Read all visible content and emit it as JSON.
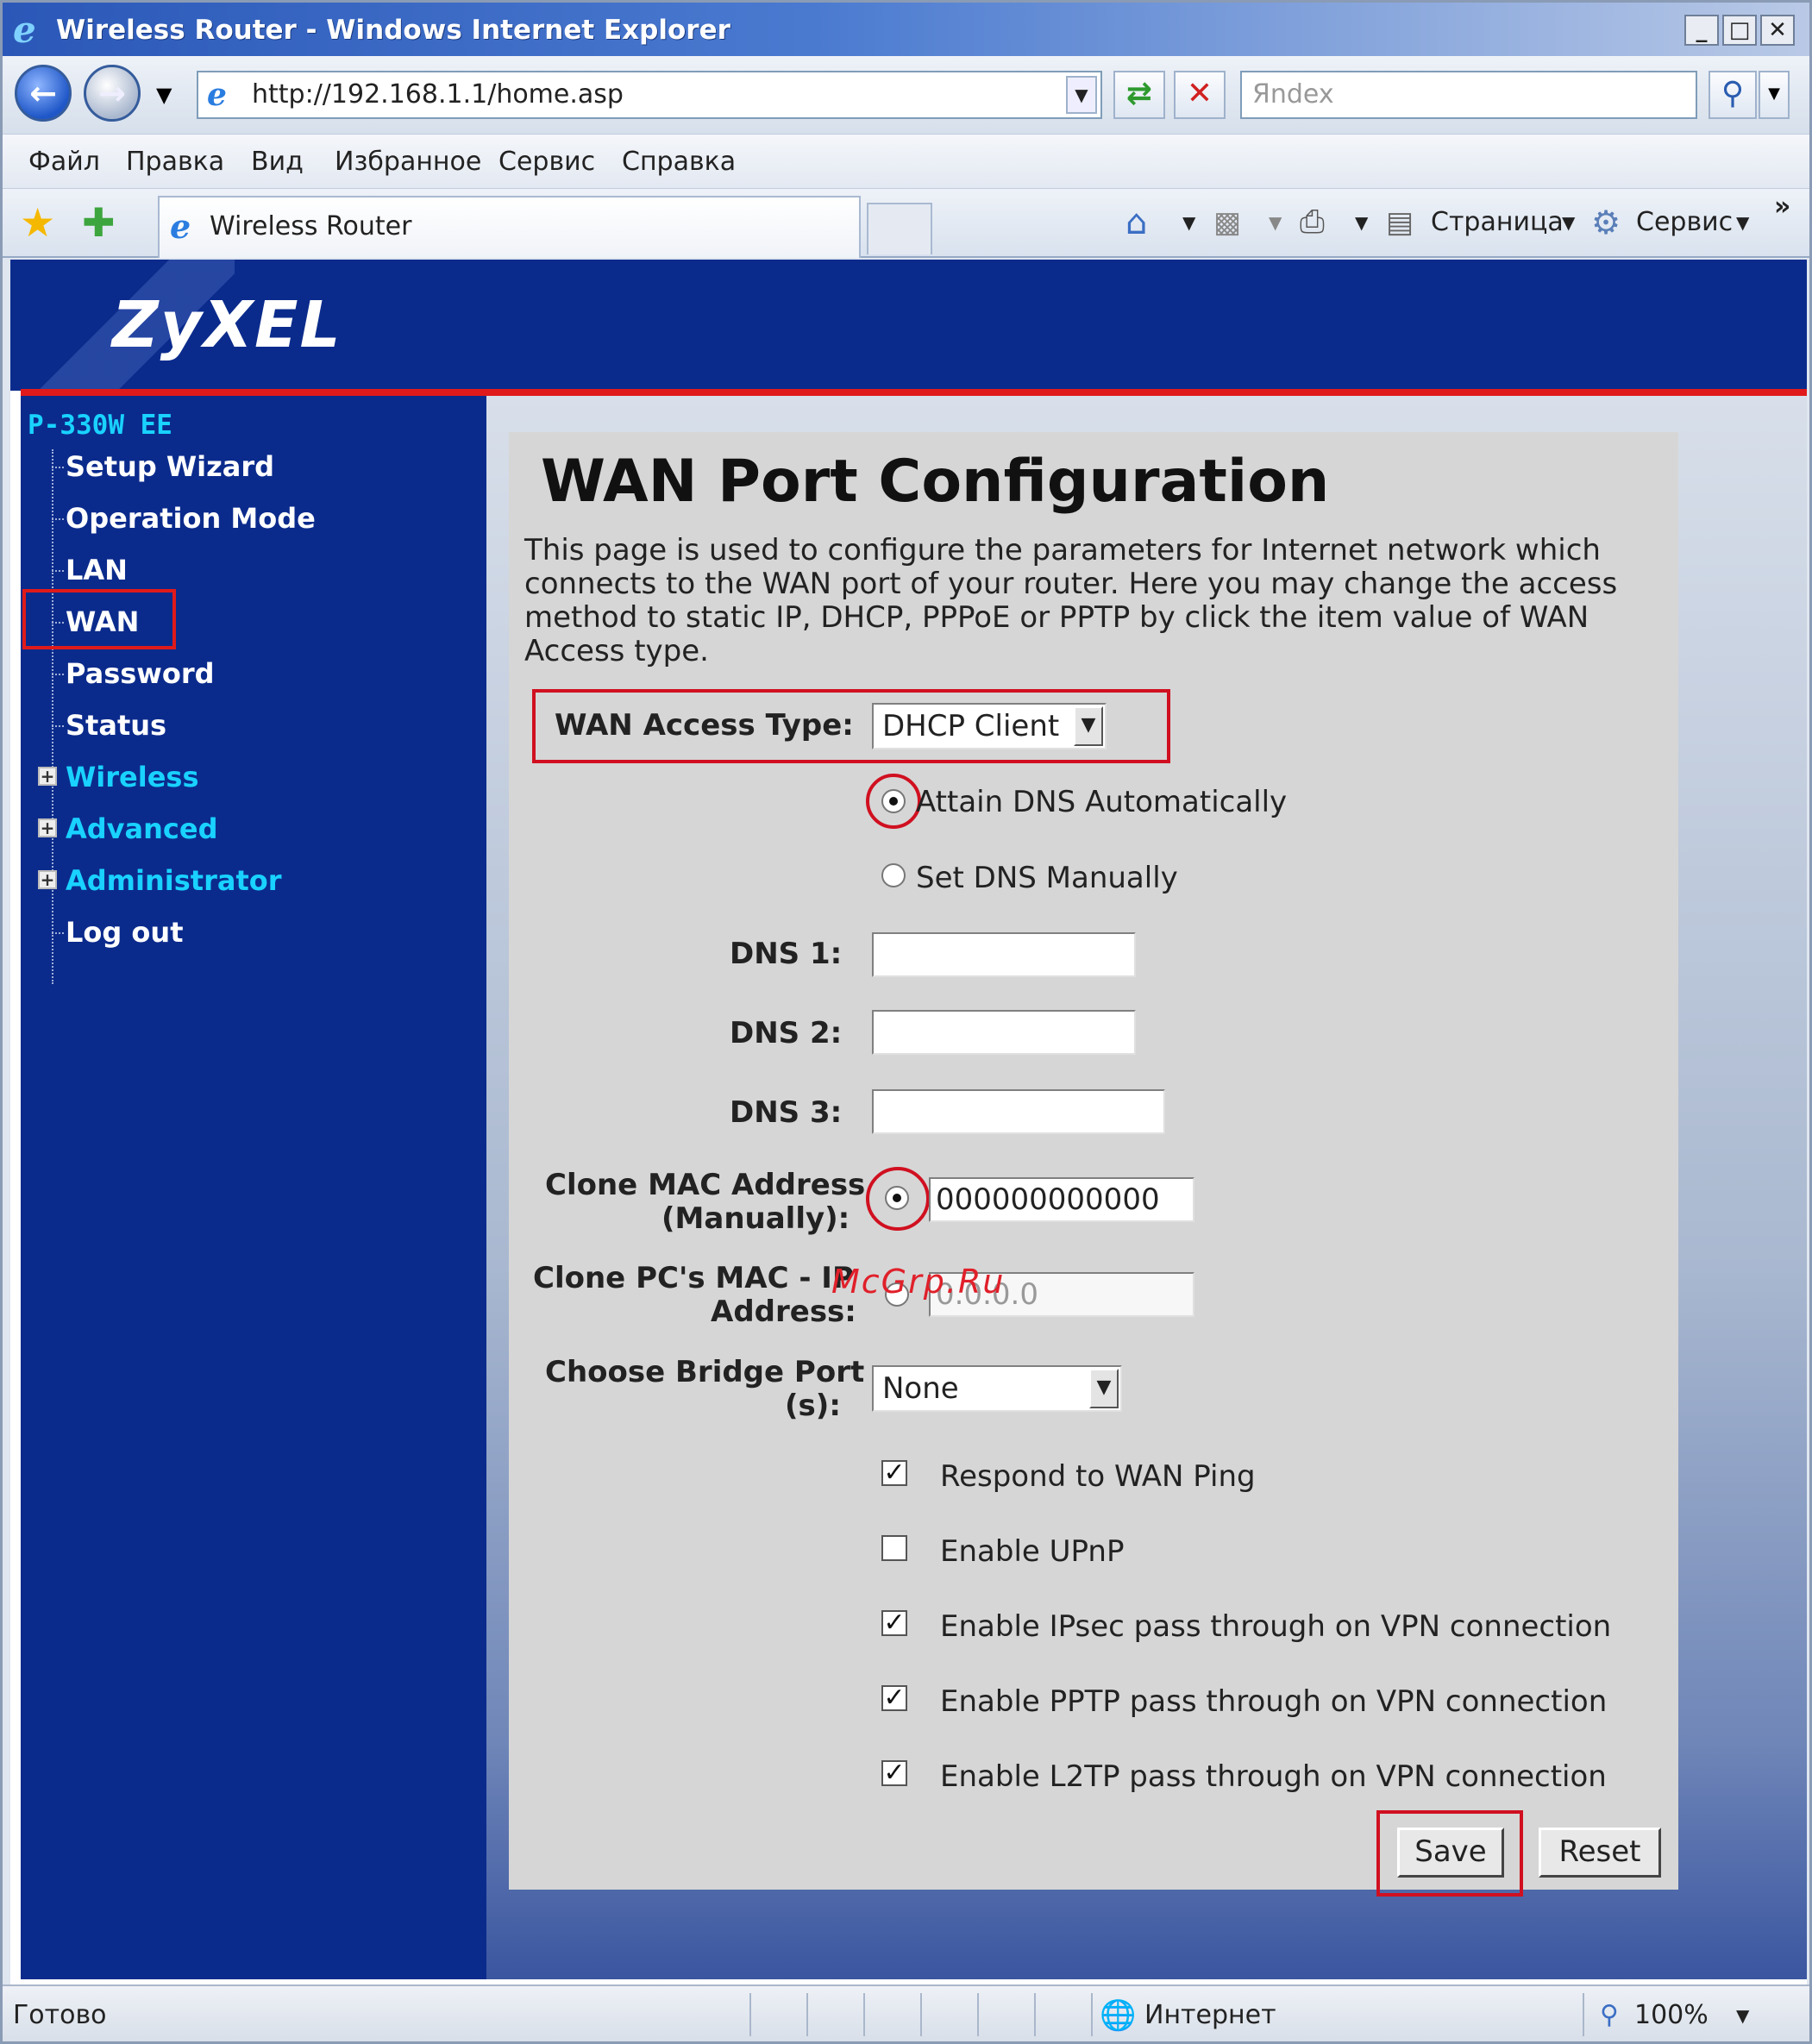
{
  "window": {
    "title": "Wireless Router - Windows Internet Explorer",
    "minimize_glyph": "_",
    "maximize_glyph": "□",
    "close_glyph": "✕"
  },
  "address_bar": {
    "url": "http://192.168.1.1/home.asp",
    "search_placeholder": "Яndex"
  },
  "menu": [
    "Файл",
    "Правка",
    "Вид",
    "Избранное",
    "Сервис",
    "Справка"
  ],
  "tab": {
    "title": "Wireless Router"
  },
  "command_bar": {
    "page_label": "Страница",
    "tools_label": "Сервис"
  },
  "router": {
    "brand": "ZyXEL",
    "model": "P-330W EE",
    "nav": [
      {
        "label": "Setup Wizard"
      },
      {
        "label": "Operation Mode"
      },
      {
        "label": "LAN"
      },
      {
        "label": "WAN"
      },
      {
        "label": "Password"
      },
      {
        "label": "Status"
      },
      {
        "label": "Wireless"
      },
      {
        "label": "Advanced"
      },
      {
        "label": "Administrator"
      },
      {
        "label": "Log out"
      }
    ]
  },
  "form": {
    "title": "WAN Port Configuration",
    "description": "This page is used to configure the parameters for Internet network which connects to the WAN port of your router. Here you may change the access method to static IP, DHCP, PPPoE or PPTP by click the item value of WAN Access type.",
    "wan_access_type_label": "WAN Access Type:",
    "wan_access_type_value": "DHCP Client",
    "dns_auto_label": "Attain DNS Automatically",
    "dns_manual_label": "Set DNS Manually",
    "dns1_label": "DNS 1:",
    "dns1_value": "",
    "dns2_label": "DNS 2:",
    "dns2_value": "",
    "dns3_label": "DNS 3:",
    "dns3_value": "",
    "clone_mac_label_1": "Clone MAC Address",
    "clone_mac_label_2": "(Manually):",
    "clone_mac_value": "000000000000",
    "clone_pc_label_1": "Clone PC's MAC - IP",
    "clone_pc_label_2": "Address:",
    "clone_pc_value": "0.0.0.0",
    "bridge_label_1": "Choose Bridge Port",
    "bridge_label_2": "(s):",
    "bridge_value": "None",
    "options": [
      {
        "label": "Respond to WAN Ping",
        "checked": true
      },
      {
        "label": "Enable UPnP",
        "checked": false
      },
      {
        "label": "Enable IPsec pass through on VPN connection",
        "checked": true
      },
      {
        "label": "Enable PPTP pass through on VPN connection",
        "checked": true
      },
      {
        "label": "Enable L2TP pass through on VPN connection",
        "checked": true
      }
    ],
    "save_label": "Save",
    "reset_label": "Reset"
  },
  "watermark": "McGrp.Ru",
  "status": {
    "text": "Готово",
    "zone": "Интернет",
    "zoom": "100%"
  }
}
